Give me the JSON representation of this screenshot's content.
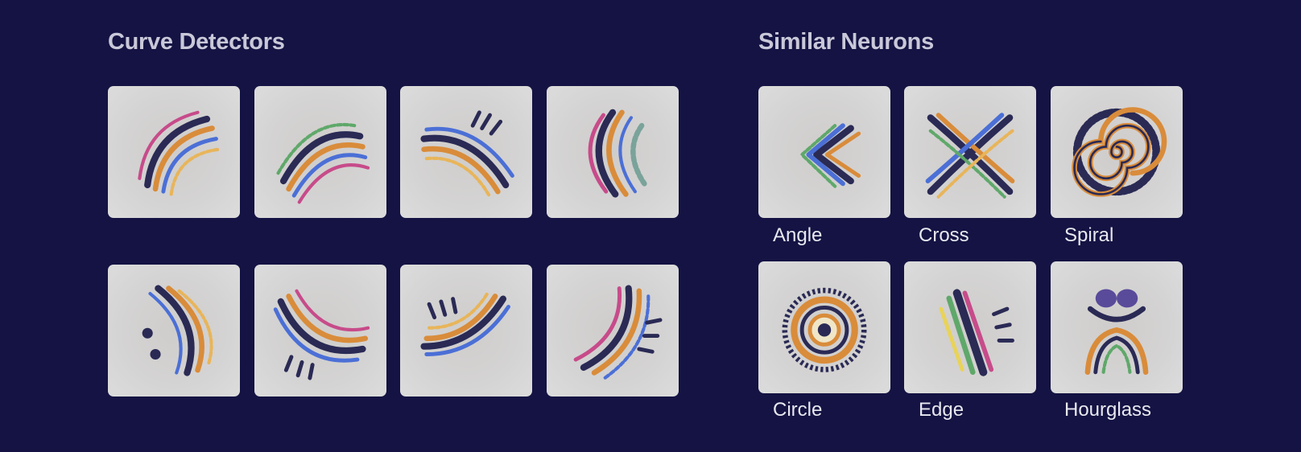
{
  "curve_detectors": {
    "title": "Curve Detectors",
    "tiles": [
      {
        "icon": "curve-visualization-icon"
      },
      {
        "icon": "curve-visualization-icon"
      },
      {
        "icon": "curve-visualization-icon"
      },
      {
        "icon": "curve-visualization-icon"
      },
      {
        "icon": "curve-visualization-icon"
      },
      {
        "icon": "curve-visualization-icon"
      },
      {
        "icon": "curve-visualization-icon"
      },
      {
        "icon": "curve-visualization-icon"
      }
    ]
  },
  "similar_neurons": {
    "title": "Similar Neurons",
    "items": [
      {
        "label": "Angle",
        "icon": "angle-visualization-icon"
      },
      {
        "label": "Cross",
        "icon": "cross-visualization-icon"
      },
      {
        "label": "Spiral",
        "icon": "spiral-visualization-icon"
      },
      {
        "label": "Circle",
        "icon": "circle-visualization-icon"
      },
      {
        "label": "Edge",
        "icon": "edge-visualization-icon"
      },
      {
        "label": "Hourglass",
        "icon": "hourglass-visualization-icon"
      }
    ]
  },
  "colors": {
    "background": "#141343",
    "tile": "#d4d3d3",
    "text": "#c9c8d9"
  }
}
